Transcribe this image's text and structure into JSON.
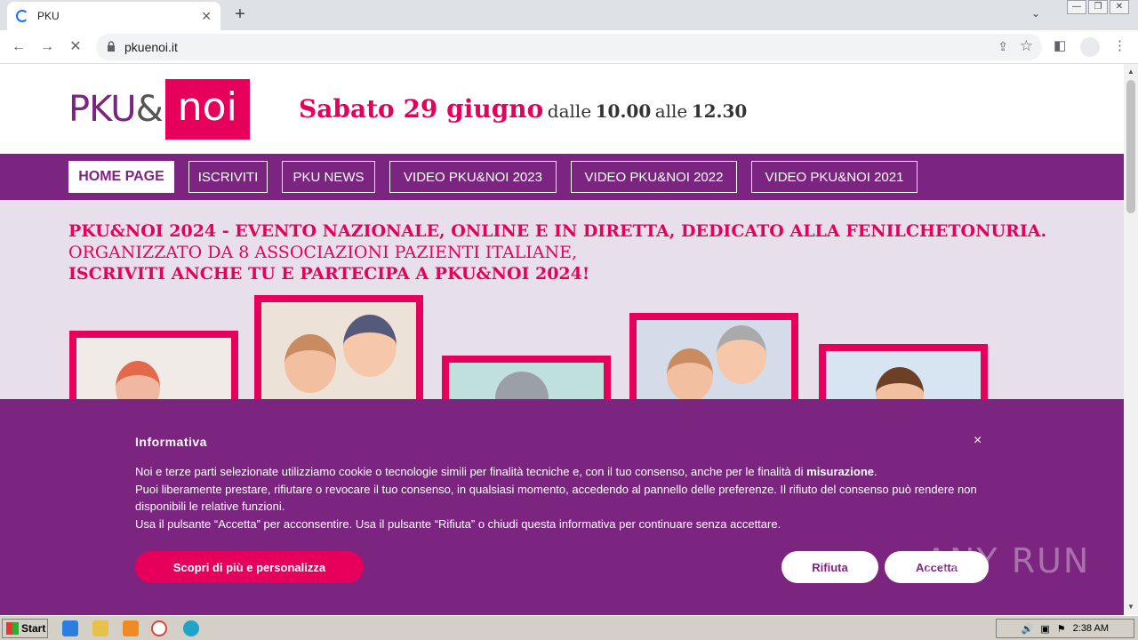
{
  "browser": {
    "tab_title": "PKU",
    "url": "pkuenoi.it",
    "window_controls": [
      "minimize-icon",
      "restore-icon",
      "close-icon"
    ]
  },
  "header": {
    "logo_pku": "PKU",
    "logo_amp": "&",
    "logo_noi": "noi",
    "date_big": "Sabato 29 giugno",
    "date_from": "dalle",
    "time_start": "10.00",
    "date_to": "alle",
    "time_end": "12.30"
  },
  "nav": {
    "items": [
      {
        "label": "HOME PAGE"
      },
      {
        "label": "ISCRIVITI"
      },
      {
        "label": "PKU NEWS"
      },
      {
        "label": "VIDEO PKU&NOI 2023"
      },
      {
        "label": "VIDEO PKU&NOI 2022"
      },
      {
        "label": "VIDEO PKU&NOI 2021"
      }
    ]
  },
  "headline": {
    "line1": "PKU&NOI 2024 - EVENTO NAZIONALE, ONLINE E IN DIRETTA, DEDICATO ALLA FENILCHETONURIA.",
    "line2": "ORGANIZZATO DA 8 ASSOCIAZIONI PAZIENTI ITALIANE,",
    "line3": "ISCRIVITI ANCHE TU E PARTECIPA A PKU&NOI 2024!"
  },
  "cookie": {
    "title": "Informativa",
    "close": "×",
    "p1_start": "Noi e terze parti selezionate utilizziamo cookie o tecnologie simili per finalità tecniche e, con il tuo consenso, anche per le finalità di ",
    "p1_bold": "misurazione",
    "p1_end": ".",
    "p2": "Puoi liberamente prestare, rifiutare o revocare il tuo consenso, in qualsiasi momento, accedendo al pannello delle preferenze. Il rifiuto del consenso può rendere non disponibili le relative funzioni.",
    "p3": "Usa il pulsante “Accetta” per acconsentire. Usa il pulsante “Rifiuta” o chiudi questa informativa per continuare senza accettare.",
    "btn_more": "Scopri di più e personalizza",
    "btn_refuse": "Rifiuta",
    "btn_accept": "Accetta"
  },
  "watermark": "ANY RUN",
  "taskbar": {
    "start": "Start",
    "clock": "2:38 AM"
  },
  "colors": {
    "brand_purple": "#7b2580",
    "brand_pink": "#e6005c"
  }
}
